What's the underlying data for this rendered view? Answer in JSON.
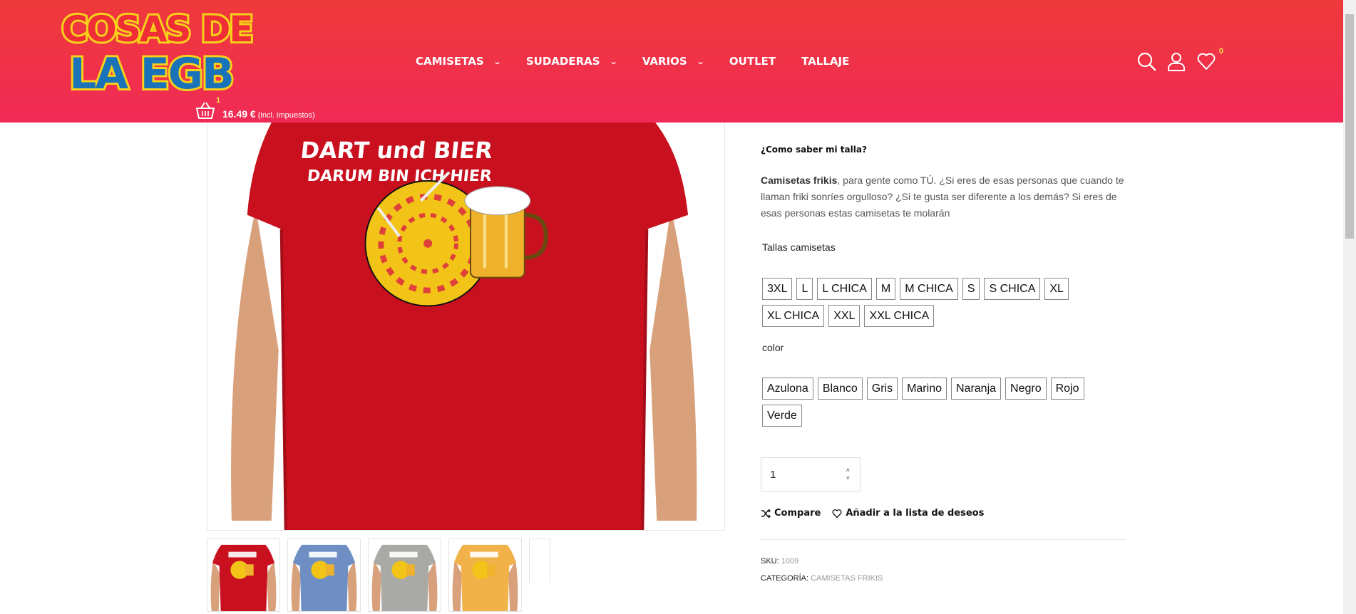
{
  "header": {
    "logo_text_line1": "COSAS DE",
    "logo_text_line2": "LA EGB",
    "nav": [
      {
        "label": "CAMISETAS",
        "has_dropdown": true
      },
      {
        "label": "SUDADERAS",
        "has_dropdown": true
      },
      {
        "label": "VARIOS",
        "has_dropdown": true
      },
      {
        "label": "OUTLET",
        "has_dropdown": false
      },
      {
        "label": "TALLAJE",
        "has_dropdown": false
      }
    ],
    "icons": [
      "search-icon",
      "user-icon",
      "heart-icon"
    ],
    "wishlist_count": "0",
    "cart": {
      "count": "1",
      "price": "16.49 €",
      "tax_note": "(incl. impuestos)"
    },
    "colors": {
      "gradient_top": "#ef3a3a",
      "gradient_bottom": "#f02a56",
      "badge": "#ffe14a"
    }
  },
  "product": {
    "artwork_line1": "DART und BIER",
    "artwork_line2": "DARUM BIN ICH HIER",
    "shirt_color": "#c8101e",
    "thumbnails": [
      {
        "color_name": "Rojo",
        "hex": "#c8101e"
      },
      {
        "color_name": "Azulona",
        "hex": "#6f8fc4"
      },
      {
        "color_name": "Gris",
        "hex": "#a9aaa6"
      },
      {
        "color_name": "Naranja",
        "hex": "#f2b24a"
      }
    ],
    "size_help": "¿Como saber mi talla?",
    "description_bold": "Camisetas frikis",
    "description_rest": ", para gente como TÚ. ¿Si eres de esas personas que cuando te llaman friki sonríes orgulloso? ¿Si te gusta ser diferente a los demás? Si eres de esas personas estas camisetas te molarán",
    "sizes_label": "Tallas camisetas",
    "sizes": [
      "3XL",
      "L",
      "L CHICA",
      "M",
      "M CHICA",
      "S",
      "S CHICA",
      "XL",
      "XL CHICA",
      "XXL",
      "XXL CHICA"
    ],
    "color_label": "color",
    "colors": [
      "Azulona",
      "Blanco",
      "Gris",
      "Marino",
      "Naranja",
      "Negro",
      "Rojo",
      "Verde"
    ],
    "quantity": "1",
    "compare_label": "Compare",
    "wishlist_label": "Añadir a la lista de deseos",
    "sku_label": "SKU:",
    "sku_value": "1009",
    "category_label": "CATEGORÍA:",
    "category_value": "CAMISETAS FRIKIS"
  }
}
